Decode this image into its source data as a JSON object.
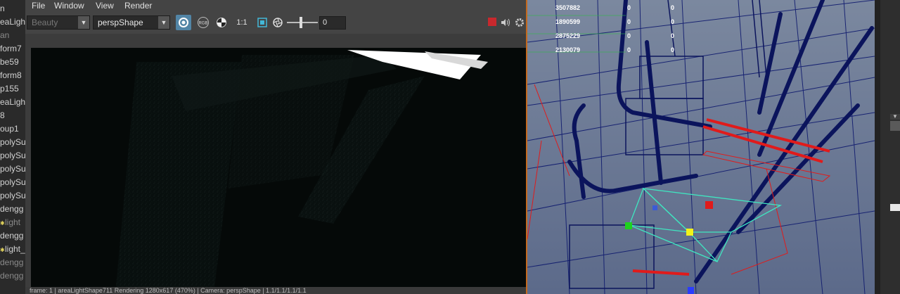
{
  "outliner": {
    "items": [
      {
        "label": "n",
        "dim": false,
        "icon": false
      },
      {
        "label": "eaLight",
        "dim": false,
        "icon": false
      },
      {
        "label": "an",
        "dim": true,
        "icon": false
      },
      {
        "label": "form7",
        "dim": false,
        "icon": false
      },
      {
        "label": "be59",
        "dim": false,
        "icon": false
      },
      {
        "label": "form8",
        "dim": false,
        "icon": false
      },
      {
        "label": "p155",
        "dim": false,
        "icon": false
      },
      {
        "label": "eaLight",
        "dim": false,
        "icon": false
      },
      {
        "label": "8",
        "dim": false,
        "icon": false
      },
      {
        "label": "oup1",
        "dim": false,
        "icon": false
      },
      {
        "label": "polySu",
        "dim": false,
        "icon": false
      },
      {
        "label": "polySu",
        "dim": false,
        "icon": false
      },
      {
        "label": "polySu",
        "dim": false,
        "icon": false
      },
      {
        "label": "polySu",
        "dim": false,
        "icon": false
      },
      {
        "label": "polySu",
        "dim": false,
        "icon": false
      },
      {
        "label": "dengg",
        "dim": false,
        "icon": false
      },
      {
        "label": "light",
        "dim": true,
        "icon": true
      },
      {
        "label": "dengg",
        "dim": false,
        "icon": false
      },
      {
        "label": "light_",
        "dim": false,
        "icon": true
      },
      {
        "label": "dengg",
        "dim": true,
        "icon": false
      },
      {
        "label": "dengg",
        "dim": true,
        "icon": false
      }
    ]
  },
  "renderview": {
    "menu": [
      "File",
      "Window",
      "View",
      "Render"
    ],
    "layer_dropdown": "Beauty",
    "camera_dropdown": "perspShape",
    "ratio_label": "1:1",
    "exposure_value": "0",
    "rgb_label": "RGB",
    "status_text": "frame: 1  |  areaLightShape711  Rendering  1280x617 (470%)  |  Camera: perspShape  |  1.1/1.1/1.1/1.1"
  },
  "viewport": {
    "hud_rows": [
      {
        "count": "3507882",
        "a": "0",
        "b": "0"
      },
      {
        "count": "1890599",
        "a": "0",
        "b": "0"
      },
      {
        "count": "2875229",
        "a": "0",
        "b": "0"
      },
      {
        "count": "2130079",
        "a": "0",
        "b": "0"
      }
    ]
  },
  "colors": {
    "accent_orange": "#c46a1f",
    "viewport_bg": "#6a7996",
    "wire_navy": "#0f1a6e",
    "selection_red": "#e01b1b",
    "manip_cyan": "#3fe6c0"
  }
}
